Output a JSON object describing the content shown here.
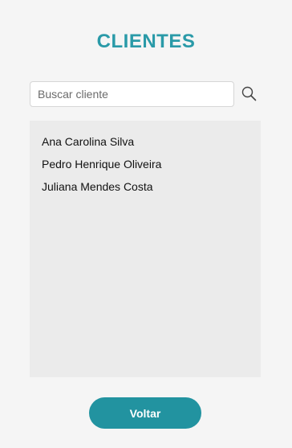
{
  "page": {
    "title": "CLIENTES"
  },
  "search": {
    "placeholder": "Buscar cliente",
    "value": "",
    "icon": "search-icon"
  },
  "clients": {
    "items": [
      {
        "name": "Ana Carolina Silva"
      },
      {
        "name": "Pedro Henrique Oliveira"
      },
      {
        "name": "Juliana Mendes Costa"
      }
    ]
  },
  "actions": {
    "back_label": "Voltar"
  },
  "colors": {
    "accent": "#2a9aa8",
    "button": "#2293a0",
    "background": "#f5f5f5",
    "list_background": "#ebebeb"
  }
}
